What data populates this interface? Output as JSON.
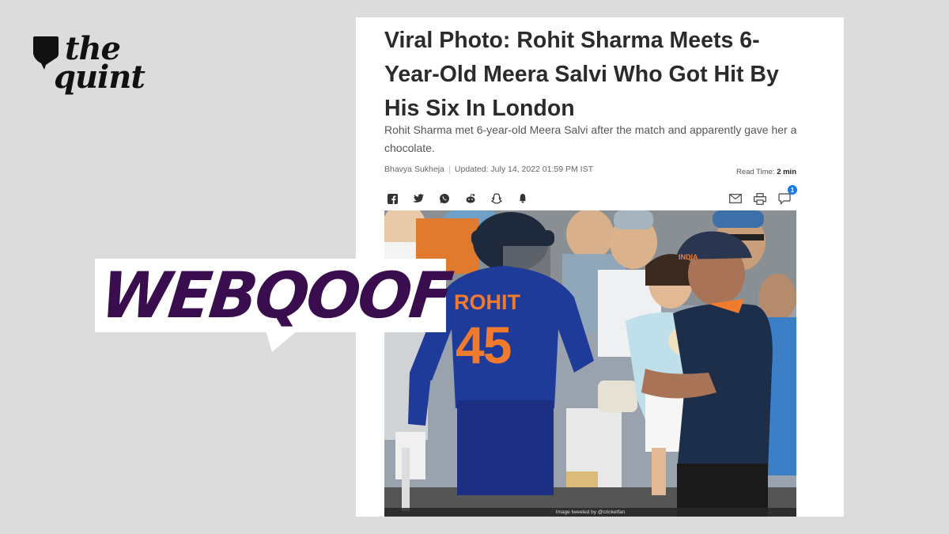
{
  "brand": {
    "line1": "the",
    "line2": "quint"
  },
  "badge": {
    "label": "WEBQOOF",
    "color": "#3a0d4e"
  },
  "article": {
    "headline": "Viral Photo: Rohit Sharma Meets 6-Year-Old Meera Salvi Who Got Hit By His Six In London",
    "subhead": "Rohit Sharma met 6-year-old Meera Salvi after the match and apparently gave her a chocolate.",
    "author": "Bhavya Sukheja",
    "updated": "Updated: July 14, 2022 01:59 PM IST",
    "read_time_label": "Read Time:",
    "read_time_value": "2 min",
    "share_icons": [
      "facebook-icon",
      "twitter-icon",
      "whatsapp-icon",
      "reddit-icon",
      "linkedin-icon",
      "snapchat-icon"
    ],
    "tool_icons": [
      "mail-icon",
      "print-icon",
      "comment-icon"
    ],
    "comment_count": "1",
    "photo": {
      "jersey_name": "ROHIT",
      "jersey_number": "45",
      "cap_text": "INDIA",
      "credit": "Image tweeted by @cricketfan"
    }
  }
}
